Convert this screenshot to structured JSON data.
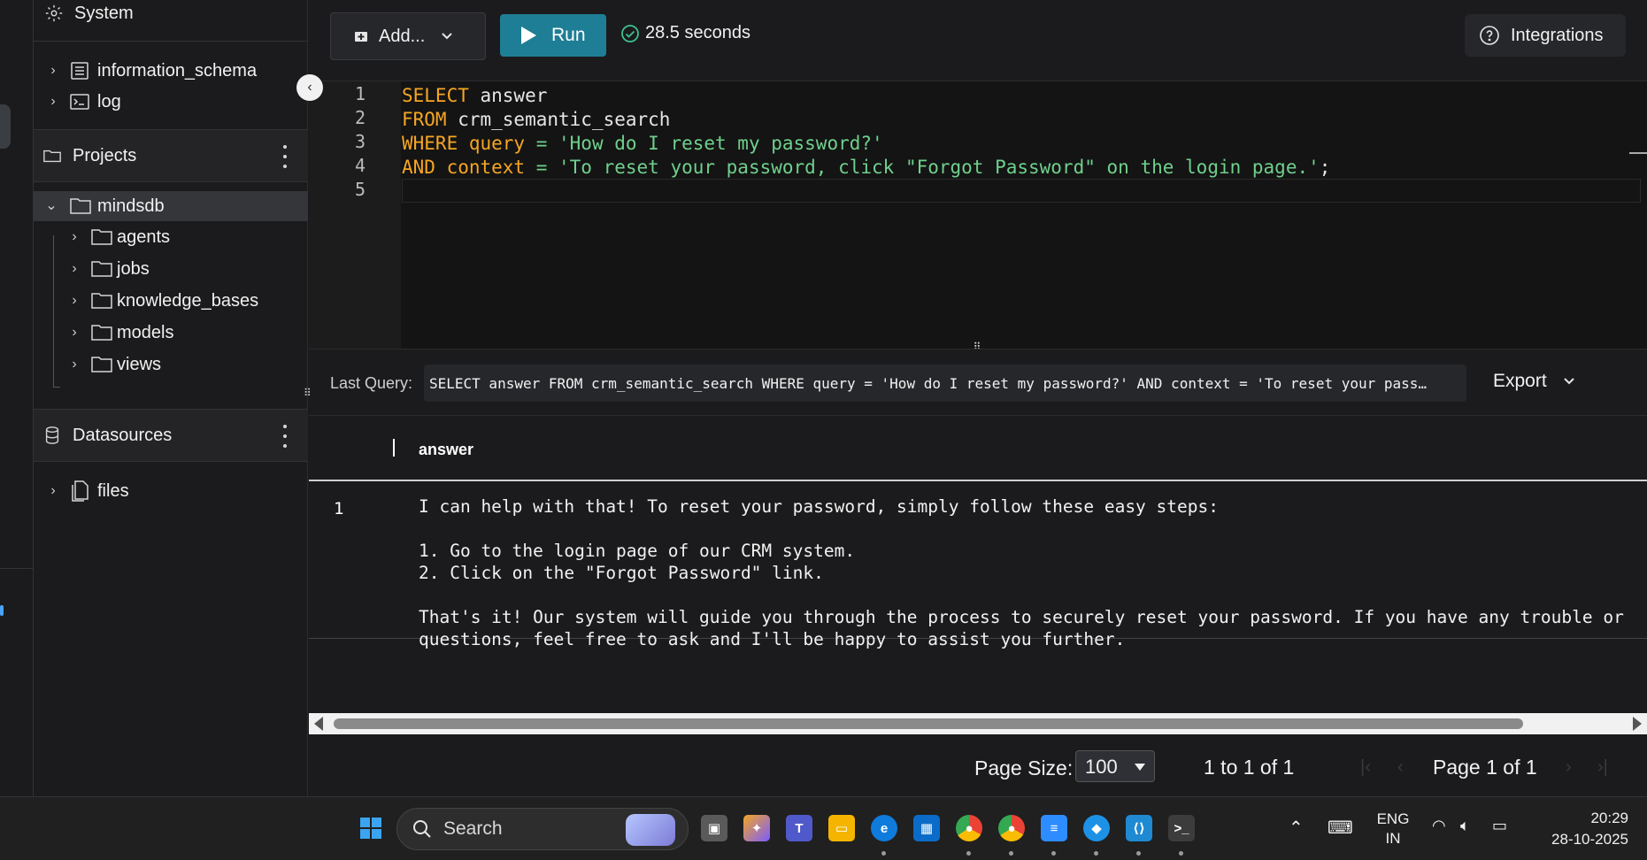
{
  "sidebar": {
    "system_label": "System",
    "system_items": [
      {
        "label": "information_schema",
        "icon": "table-icon"
      },
      {
        "label": "log",
        "icon": "terminal-icon"
      }
    ],
    "projects_label": "Projects",
    "project": {
      "name": "mindsdb",
      "children": [
        "agents",
        "jobs",
        "knowledge_bases",
        "models",
        "views"
      ]
    },
    "datasources_label": "Datasources",
    "files_label": "files"
  },
  "toolbar": {
    "add_label": "Add...",
    "run_label": "Run",
    "status_text": "28.5 seconds",
    "integrations_label": "Integrations"
  },
  "editor": {
    "line_numbers": [
      "1",
      "2",
      "3",
      "4",
      "5"
    ],
    "lines": [
      {
        "kw": "SELECT",
        "rest": " answer"
      },
      {
        "kw": "FROM",
        "rest": " crm_semantic_search"
      },
      {
        "kw": "WHERE query",
        "op": " = ",
        "str": "'How do I reset my password?'"
      },
      {
        "kw": "AND context",
        "op": " = ",
        "str": "'To reset your password, click \"Forgot Password\" on the login page.'",
        "tail": ";"
      }
    ]
  },
  "last_query": {
    "label": "Last Query:",
    "value": "SELECT answer FROM crm_semantic_search WHERE query = 'How do I reset my password?' AND context = 'To reset your pass…",
    "export_label": "Export"
  },
  "results": {
    "columns": [
      "answer"
    ],
    "rows": [
      {
        "index": "1",
        "answer": "I can help with that! To reset your password, simply follow these easy steps:\n\n1. Go to the login page of our CRM system.\n2. Click on the \"Forgot Password\" link.\n\nThat's it! Our system will guide you through the process to securely reset your password. If you have any trouble or questions, feel free to ask and I'll be happy to assist you further."
      }
    ]
  },
  "pagination": {
    "page_size_label": "Page Size:",
    "page_size_value": "100",
    "range_text": "1 to 1 of 1",
    "page_text": "Page 1 of 1"
  },
  "taskbar": {
    "search_placeholder": "Search",
    "language": "ENG",
    "region": "IN",
    "time": "20:29",
    "date": "28-10-2025"
  },
  "colors": {
    "run_button": "#1e7e95",
    "keyword": "#f6a623",
    "string": "#6fd08c",
    "success": "#3ec28f"
  }
}
